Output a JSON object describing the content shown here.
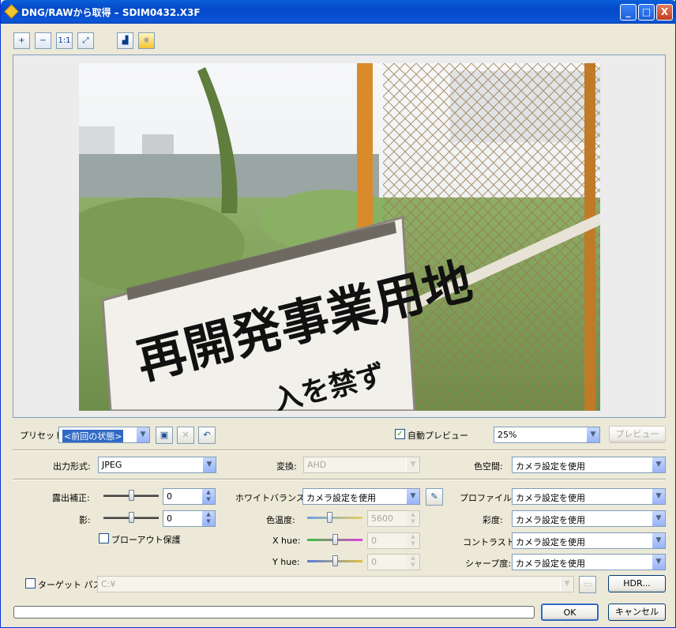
{
  "window": {
    "title": "DNG/RAWから取得 – SDIM0432.X3F"
  },
  "title_buttons": {
    "minimize": "_",
    "maximize": "□",
    "close": "X"
  },
  "toolbar": {
    "zoom_in": "+",
    "zoom_out": "−",
    "actual": "1:1",
    "fit": "⤢",
    "histogram": "▟",
    "effects": "☼"
  },
  "preview": {
    "sign_line1": "再開発事業用地",
    "sign_line2": "入を禁ず"
  },
  "preset": {
    "label": "プリセット:",
    "value": "<前回の状態>",
    "auto_preview_label": "自動プレビュー",
    "auto_preview_checked": true,
    "zoom": "25%",
    "preview_button": "プレビュー"
  },
  "output": {
    "format_label": "出力形式:",
    "format_value": "JPEG",
    "convert_label": "変換:",
    "convert_value": "AHD",
    "colorspace_label": "色空間:",
    "colorspace_value": "カメラ設定を使用"
  },
  "exposure": {
    "label": "露出補正:",
    "value": "0",
    "slider_fraction": 0.5
  },
  "shadow": {
    "label": "影:",
    "value": "0",
    "slider_fraction": 0.5
  },
  "blowout": {
    "label": "ブローアウト保護",
    "checked": false
  },
  "white_balance": {
    "label": "ホワイトバランス:",
    "value": "カメラ設定を使用"
  },
  "color_temp": {
    "label": "色温度:",
    "value": "5600",
    "slider_fraction": 0.4
  },
  "x_hue": {
    "label": "X hue:",
    "value": "0",
    "slider_fraction": 0.5
  },
  "y_hue": {
    "label": "Y hue:",
    "value": "0",
    "slider_fraction": 0.5
  },
  "profile": {
    "label": "プロファイル:",
    "value": "カメラ設定を使用"
  },
  "saturation": {
    "label": "彩度:",
    "value": "カメラ設定を使用"
  },
  "contrast": {
    "label": "コントラスト:",
    "value": "カメラ設定を使用"
  },
  "sharpness": {
    "label": "シャープ度:",
    "value": "カメラ設定を使用"
  },
  "target": {
    "label": "ターゲット パス:",
    "value": "C:¥",
    "checked": false,
    "hdr_button": "HDR..."
  },
  "footer": {
    "ok": "OK",
    "cancel": "キャンセル",
    "progress": 0
  },
  "colors": {
    "titlebar": "#0348c9",
    "window_bg": "#ece9d8",
    "border": "#7f9db9"
  }
}
